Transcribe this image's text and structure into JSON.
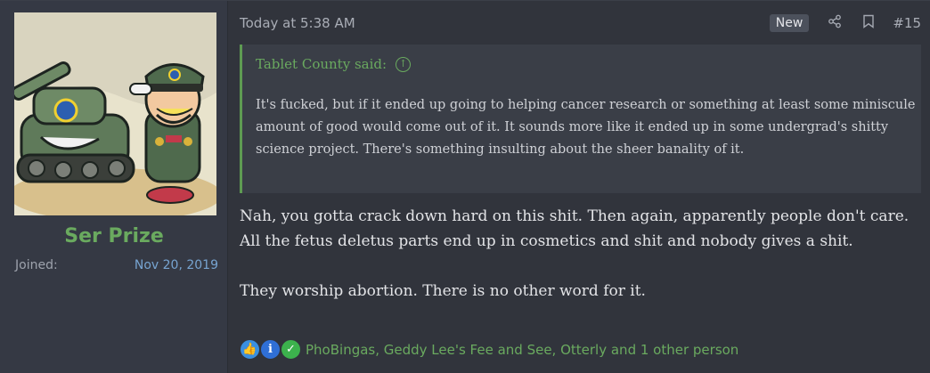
{
  "user": {
    "name": "Ser Prize",
    "joined_label": "Joined:",
    "joined_date": "Nov 20, 2019"
  },
  "post": {
    "time": "Today at 5:38 AM",
    "badge": "New",
    "number": "#15",
    "icons": [
      "share-icon",
      "bookmark-icon"
    ]
  },
  "quote": {
    "author": "Tablet County said:",
    "body": "It's fucked, but if it ended up going to helping cancer research or something at least some miniscule amount of good would come out of it. It sounds more like it ended up in some undergrad's shitty science project. There's something insulting about the sheer banality of it."
  },
  "message": {
    "paragraphs": [
      "Nah, you gotta crack down hard on this shit. Then again, apparently people don't care. All the fetus deletus parts end up in cosmetics and shit and nobody gives a shit.",
      "They worship abortion. There is no other word for it."
    ]
  },
  "reactions": {
    "icons": [
      "like-icon",
      "informative-icon",
      "agree-icon"
    ],
    "users": "PhoBingas, Geddy Lee's Fee and See, Otterly and 1 other person"
  },
  "colors": {
    "accent_green": "#6aaa5f",
    "link_blue": "#77a4d1",
    "background": "#31343c"
  }
}
